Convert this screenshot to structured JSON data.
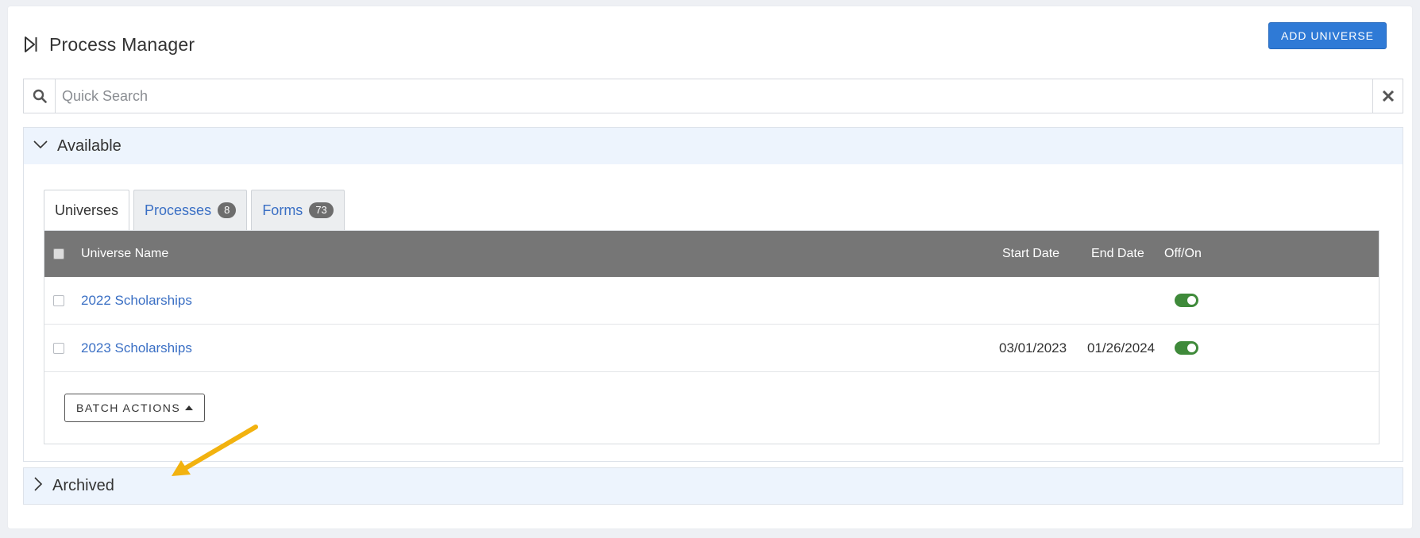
{
  "header": {
    "title": "Process Manager",
    "add_button_label": "ADD UNIVERSE"
  },
  "search": {
    "placeholder": "Quick Search",
    "value": ""
  },
  "available": {
    "label": "Available",
    "tabs": [
      {
        "label": "Universes",
        "badge": null,
        "active": true
      },
      {
        "label": "Processes",
        "badge": "8",
        "active": false
      },
      {
        "label": "Forms",
        "badge": "73",
        "active": false
      }
    ],
    "table": {
      "headers": {
        "name": "Universe Name",
        "start": "Start Date",
        "end": "End Date",
        "toggle": "Off/On"
      },
      "rows": [
        {
          "name": "2022 Scholarships",
          "start": "",
          "end": "",
          "on": true
        },
        {
          "name": "2023 Scholarships",
          "start": "03/01/2023",
          "end": "01/26/2024",
          "on": true
        }
      ]
    },
    "batch_label": "BATCH ACTIONS"
  },
  "archived": {
    "label": "Archived"
  },
  "colors": {
    "accent": "#2f7ad6",
    "link": "#3a6fc4",
    "header_bg": "#767676",
    "toggle_on": "#3f8a3a",
    "panel_bg": "#edf4fd",
    "annotation_arrow": "#f2b20f"
  },
  "icons": {
    "header": "skip-forward-icon",
    "search": "search-icon",
    "clear": "close-icon",
    "available_chevron": "chevron-down-icon",
    "archived_chevron": "chevron-right-icon"
  }
}
